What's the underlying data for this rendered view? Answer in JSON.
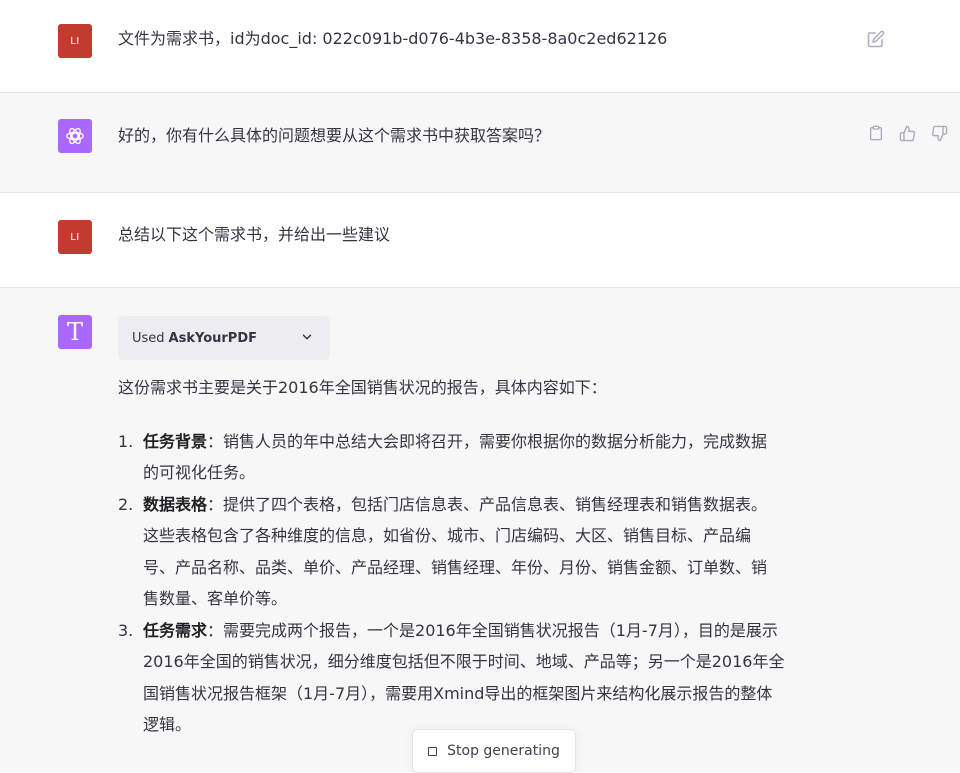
{
  "messages": [
    {
      "role": "user",
      "avatar_text": "LI",
      "text": "文件为需求书，id为doc_id: 022c091b-d076-4b3e-8358-8a0c2ed62126",
      "actions": [
        "edit-icon"
      ]
    },
    {
      "role": "assistant",
      "avatar_icon": "openai-logo-icon",
      "text": "好的，你有什么具体的问题想要从这个需求书中获取答案吗？",
      "actions": [
        "clipboard-icon",
        "thumbs-up-icon",
        "thumbs-down-icon"
      ]
    },
    {
      "role": "user",
      "avatar_text": "LI",
      "text": "总结以下这个需求书，并给出一些建议"
    },
    {
      "role": "assistant",
      "avatar_icon": "plugin-t-icon",
      "avatar_letter": "T",
      "plugin": {
        "used_label": "Used",
        "name": "AskYourPDF"
      },
      "intro": "这份需求书主要是关于2016年全国销售状况的报告，具体内容如下：",
      "items": [
        {
          "num": "1.",
          "title": "任务背景",
          "lines": [
            "：销售人员的年中总结大会即将召开，需要你根据你的数据分析能力，完成数据",
            "的可视化任务。"
          ]
        },
        {
          "num": "2.",
          "title": "数据表格",
          "lines": [
            "：提供了四个表格，包括门店信息表、产品信息表、销售经理表和销售数据表。",
            "这些表格包含了各种维度的信息，如省份、城市、门店编码、大区、销售目标、产品编",
            "号、产品名称、品类、单价、产品经理、销售经理、年份、月份、销售金额、订单数、销",
            "售数量、客单价等。"
          ]
        },
        {
          "num": "3.",
          "title": "任务需求",
          "lines": [
            "：需要完成两个报告，一个是2016年全国销售状况报告（1月-7月），目的是展示",
            "2016年全国的销售状况，细分维度包括但不限于时间、地域、产品等；另一个是2016年全",
            "国销售状况报告框架（1月-7月），需要用Xmind导出的框架图片来结构化展示报告的整体",
            "逻辑。"
          ]
        }
      ]
    }
  ],
  "stop_button": {
    "label": "Stop generating",
    "icon": "stop-square-icon"
  },
  "colors": {
    "user_avatar": "#c33a2e",
    "gpt_avatar": "#ab68ff",
    "bot_bg": "#f7f7f8",
    "text": "#343541"
  }
}
